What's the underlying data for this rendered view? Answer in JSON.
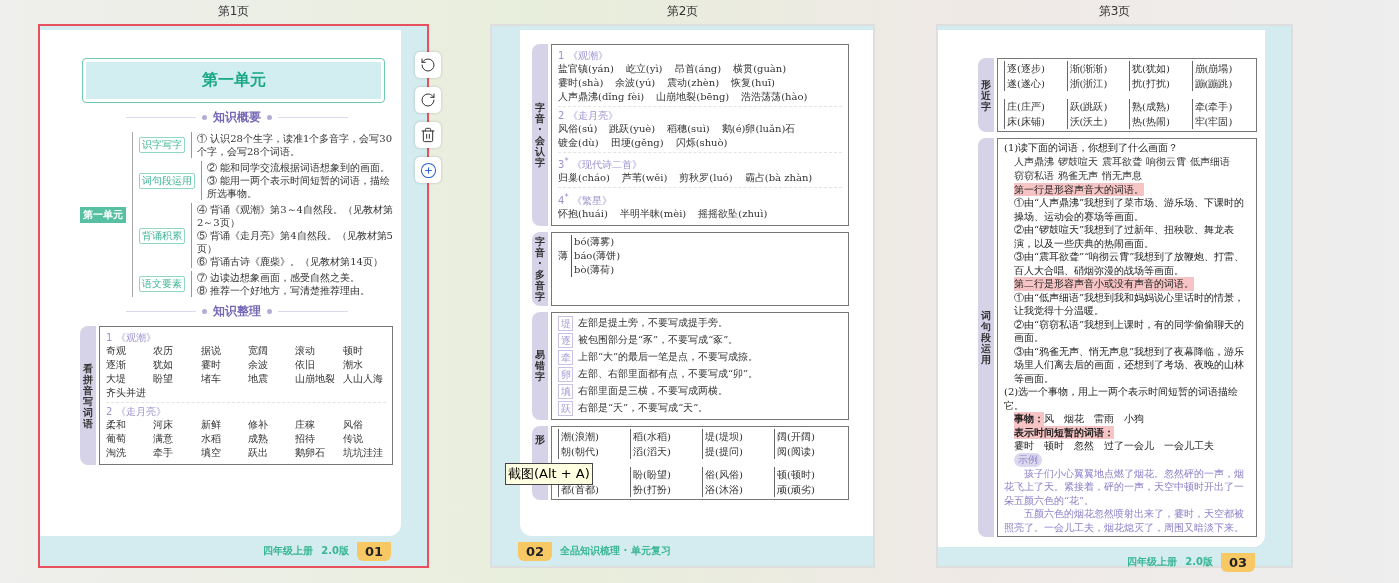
{
  "tooltip": "截图(Alt + A)",
  "pages": [
    {
      "kind": "overview",
      "label": "第1页",
      "selected": true,
      "title": "第一单元",
      "overview_heading": "知识概要",
      "mindmap": {
        "root": "第一单元",
        "branches": [
          {
            "label": "识字写字",
            "items": [
              "① 认识28个生字，读准1个多音字，会写30个字，会写28个词语。"
            ]
          },
          {
            "label": "词句段运用",
            "items": [
              "② 能和同学交流根据词语想象到的画面。",
              "③ 能用一两个表示时间短暂的词语，描绘所选事物。"
            ]
          },
          {
            "label": "背诵积累",
            "items": [
              "④ 背诵《观潮》第3～4自然段。（见教材第2～3页）",
              "⑤ 背诵《走月亮》第4自然段。（见教材第5页）",
              "⑥ 背诵古诗《鹿柴》。（见教材第14页）"
            ]
          },
          {
            "label": "语文要素",
            "items": [
              "⑦ 边读边想象画面，感受自然之美。",
              "⑧ 推荐一个好地方，写清楚推荐理由。"
            ]
          }
        ]
      },
      "table_heading": "知识整理",
      "table": {
        "side_label": "看拼音写词语",
        "groups": [
          {
            "title": "1 《观潮》",
            "words": [
              "奇观",
              "农历",
              "据说",
              "宽阔",
              "滚动",
              "顿时",
              "逐渐",
              "犹如",
              "霎时",
              "余波",
              "依旧",
              "潮水",
              "大堤",
              "盼望",
              "堵车",
              "地震",
              "山崩地裂",
              "人山人海",
              "齐头并进"
            ]
          },
          {
            "title": "2 《走月亮》",
            "words": [
              "柔和",
              "河床",
              "新鲜",
              "修补",
              "庄稼",
              "风俗",
              "葡萄",
              "满意",
              "水稻",
              "成熟",
              "招待",
              "传说",
              "淘洗",
              "牵手",
              "填空",
              "跃出",
              "鹅卵石",
              "坑坑洼洼"
            ]
          }
        ]
      },
      "footer": {
        "grade": "四年级上册",
        "edition": "2.0版",
        "number": "01"
      }
    },
    {
      "kind": "review",
      "label": "第2页",
      "selected": false,
      "sections": [
        {
          "kind": "groups",
          "side_label": "字音·会认字",
          "groups": [
            {
              "title": "1 《观潮》",
              "words": [
                "盐官镇(yán)",
                "屹立(yì)",
                "昂首(áng)",
                "横贯(guàn)",
                "霎时(shà)",
                "余波(yú)",
                "震动(zhèn)",
                "恢复(huī)",
                "人声鼎沸(dǐng fèi)",
                "山崩地裂(bēng)",
                "浩浩荡荡(hào)"
              ]
            },
            {
              "title": "2 《走月亮》",
              "words": [
                "风俗(sú)",
                "跳跃(yuè)",
                "稻穗(suì)",
                "鹅(é)卵(luǎn)石",
                "镀金(dù)",
                "田埂(gěng)",
                "闪烁(shuò)"
              ]
            },
            {
              "title": "3$^{*}$ 《现代诗二首》",
              "words": [
                "归巢(cháo)",
                "芦苇(wěi)",
                "剪秋罗(luó)",
                "霸占(bà zhàn)"
              ]
            },
            {
              "title": "4$^{*}$ 《繁星》",
              "words": [
                "怀抱(huái)",
                "半明半昧(mèi)",
                "摇摇欲坠(zhuì)"
              ]
            }
          ]
        },
        {
          "kind": "polyphone",
          "side_label": "字音·多音字",
          "char": "薄",
          "readings": [
            "bó(薄雾)",
            "báo(薄饼)",
            "bò(薄荷)"
          ]
        },
        {
          "kind": "errors",
          "side_label": "易错字",
          "items": [
            {
              "char": "堤",
              "text": "左部是提土旁，不要写成提手旁。"
            },
            {
              "char": "逐",
              "text": "被包围部分是“豕”，不要写成“豖”。"
            },
            {
              "char": "牵",
              "text": "上部“大”的最后一笔是点，不要写成捺。"
            },
            {
              "char": "卵",
              "text": "左部、右部里面都有点，不要写成“卯”。"
            },
            {
              "char": "填",
              "text": "右部里面是三横，不要写成两横。"
            },
            {
              "char": "跃",
              "text": "右部是“夭”，不要写成“天”。"
            }
          ]
        },
        {
          "kind": "pairs",
          "side_label": "形",
          "pairs": [
            {
              "top": "潮(浪潮)",
              "bottom": "朝(朝代)"
            },
            {
              "top": "稻(水稻)",
              "bottom": "滔(滔天)"
            },
            {
              "top": "堤(堤坝)",
              "bottom": "提(提问)"
            },
            {
              "top": "阔(开阔)",
              "bottom": "阅(阅读)"
            },
            {
              "bottom": "都(首都)"
            },
            {
              "top": "盼(盼望)",
              "bottom": "扮(打扮)"
            },
            {
              "top": "俗(风俗)",
              "bottom": "浴(沐浴)"
            },
            {
              "top": "顿(顿时)",
              "bottom": "顽(顽劣)"
            }
          ]
        }
      ],
      "footer": {
        "number": "02",
        "series": "全品知识梳理 · 单元复习"
      }
    },
    {
      "kind": "review",
      "label": "第3页",
      "selected": false,
      "sections": [
        {
          "kind": "pairs",
          "side_label": "形近字",
          "pairs": [
            {
              "top": "逐(逐步)",
              "bottom": "遂(遂心)"
            },
            {
              "top": "渐(渐渐)",
              "bottom": "浙(浙江)"
            },
            {
              "top": "犹(犹如)",
              "bottom": "扰(打扰)"
            },
            {
              "top": "崩(崩塌)",
              "bottom": "蹦(蹦跳)"
            },
            {
              "top": "庄(庄严)",
              "bottom": "床(床铺)"
            },
            {
              "top": "跃(跳跃)",
              "bottom": "沃(沃土)"
            },
            {
              "top": "熟(成熟)",
              "bottom": "热(热闹)"
            },
            {
              "top": "牵(牵手)",
              "bottom": "牢(牢固)"
            }
          ]
        },
        {
          "kind": "practice",
          "side_label": "词句段运用",
          "blocks": [
            {
              "kind": "question",
              "text": "(1)读下面的词语，你想到了什么画面？"
            },
            {
              "kind": "words",
              "words": [
                "人声鼎沸",
                "锣鼓喧天",
                "震耳欲聋",
                "响彻云霄",
                "低声细语",
                "窃窃私语",
                "鸦雀无声",
                "悄无声息"
              ]
            },
            {
              "kind": "highlight",
              "text": "第一行是形容声音大的词语。"
            },
            {
              "kind": "para",
              "text": "①由“人声鼎沸”我想到了菜市场、游乐场、下课时的操场、运动会的赛场等画面。"
            },
            {
              "kind": "para",
              "text": "②由“锣鼓喧天”我想到了过新年、扭秧歌、舞龙表演，以及一些庆典的热闹画面。"
            },
            {
              "kind": "para",
              "text": "③由“震耳欲聋”“响彻云霄”我想到了放鞭炮、打雷、百人大合唱、硝烟弥漫的战场等画面。"
            },
            {
              "kind": "highlight",
              "text": "第二行是形容声音小或没有声音的词语。"
            },
            {
              "kind": "para",
              "text": "①由“低声细语”我想到我和妈妈说心里话时的情景，让我觉得十分温暖。"
            },
            {
              "kind": "para",
              "text": "②由“窃窃私语”我想到上课时，有的同学偷偷聊天的画面。"
            },
            {
              "kind": "para",
              "text": "③由“鸦雀无声、悄无声息”我想到了夜幕降临，游乐场里人们离去后的画面，还想到了考场、夜晚的山林等画面。"
            },
            {
              "kind": "question",
              "text": "(2)选一个事物，用上一两个表示时间短暂的词语描绘它。"
            },
            {
              "kind": "labeled",
              "label": "事物：",
              "text": "风　烟花　雷雨　小狗"
            },
            {
              "kind": "labeled",
              "label": "表示时间短暂的词语：",
              "text": "霎时　顿时　忽然　过了一会儿　一会儿工夫"
            },
            {
              "kind": "tag",
              "text": "示例"
            },
            {
              "kind": "example",
              "text": "孩子们小心翼翼地点燃了烟花。忽然砰的一声，烟花飞上了天。紧接着，砰的一声，天空中顿时开出了一朵五颜六色的“花”。"
            },
            {
              "kind": "example",
              "text": "五颜六色的烟花忽然喷射出来了，霎时，天空都被照亮了。一会儿工夫，烟花熄灭了，周围又暗淡下来。"
            }
          ]
        }
      ],
      "footer": {
        "grade": "四年级上册",
        "edition": "2.0版",
        "number": "03"
      }
    }
  ]
}
